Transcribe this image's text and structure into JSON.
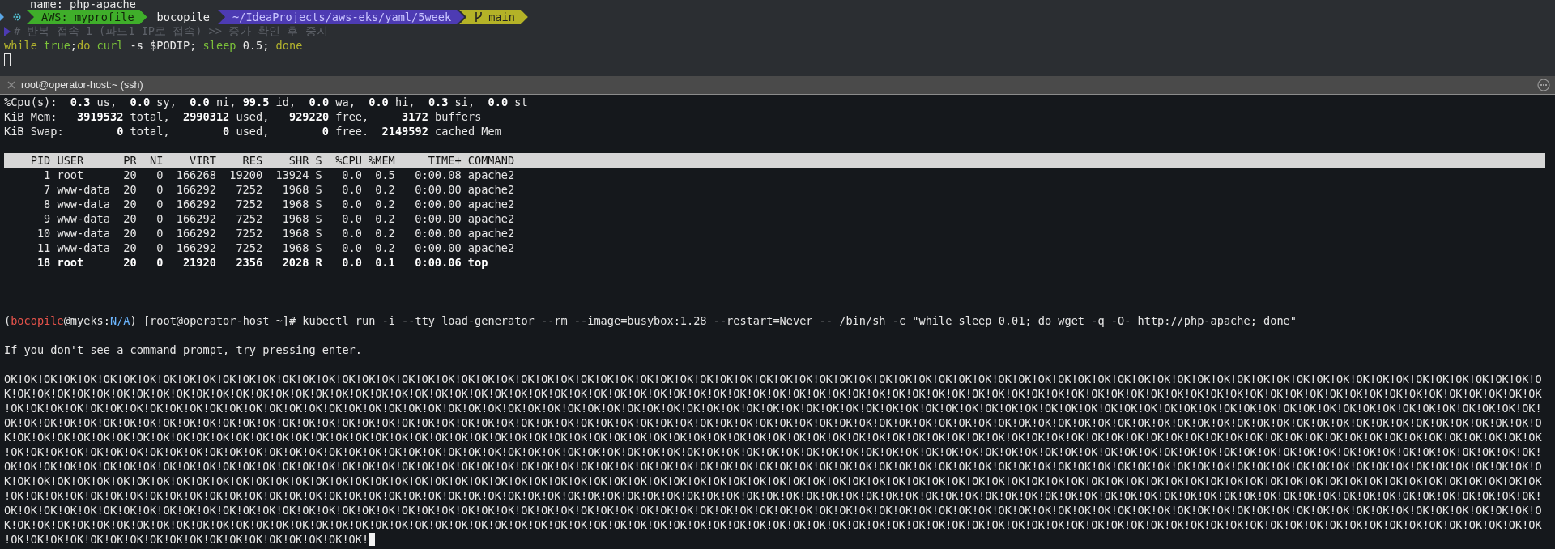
{
  "top_pane": {
    "clipped_line": "name: php-apache",
    "prompt_segments": [
      {
        "kind": "aws",
        "text": "AWS: myprofile"
      },
      {
        "kind": "user",
        "text": "bocopile"
      },
      {
        "kind": "path",
        "text": "~/IdeaProjects/aws-eks/yaml/5week"
      },
      {
        "kind": "git",
        "text": "main"
      }
    ],
    "comment": "# 반복 접속 1 (파드1 IP로 접속) >> 증가 확인 후 중지",
    "command": [
      {
        "kind": "keyword",
        "text": "while "
      },
      {
        "kind": "builtin",
        "text": "true"
      },
      {
        "kind": "plain",
        "text": ";"
      },
      {
        "kind": "keyword",
        "text": "do "
      },
      {
        "kind": "builtin",
        "text": "curl"
      },
      {
        "kind": "plain",
        "text": " -s $PODIP; "
      },
      {
        "kind": "builtin",
        "text": "sleep"
      },
      {
        "kind": "plain",
        "text": " 0.5; "
      },
      {
        "kind": "keyword",
        "text": "done"
      }
    ]
  },
  "tab": {
    "title": "root@operator-host:~ (ssh)"
  },
  "screen": {
    "stats": [
      "%Cpu(s):  **0.3** us,  **0.0** sy,  **0.0** ni, **99.5** id,  **0.0** wa,  **0.0** hi,  **0.3** si,  **0.0** st",
      "KiB Mem:   **3919532** total,  **2990312** used,   **929220** free,     **3172** buffers",
      "KiB Swap:        **0** total,        **0** used,        **0** free.  **2149592** cached Mem"
    ],
    "table": {
      "columns": [
        "PID",
        "USER",
        "PR",
        "NI",
        "VIRT",
        "RES",
        "SHR",
        "S",
        "%CPU",
        "%MEM",
        "TIME+",
        "COMMAND"
      ],
      "rows": [
        {
          "emphasized": false,
          "cells": [
            "1",
            "root",
            "20",
            "0",
            "166268",
            "19200",
            "13924",
            "S",
            "0.0",
            "0.5",
            "0:00.08",
            "apache2"
          ]
        },
        {
          "emphasized": false,
          "cells": [
            "7",
            "www-data",
            "20",
            "0",
            "166292",
            "7252",
            "1968",
            "S",
            "0.0",
            "0.2",
            "0:00.00",
            "apache2"
          ]
        },
        {
          "emphasized": false,
          "cells": [
            "8",
            "www-data",
            "20",
            "0",
            "166292",
            "7252",
            "1968",
            "S",
            "0.0",
            "0.2",
            "0:00.00",
            "apache2"
          ]
        },
        {
          "emphasized": false,
          "cells": [
            "9",
            "www-data",
            "20",
            "0",
            "166292",
            "7252",
            "1968",
            "S",
            "0.0",
            "0.2",
            "0:00.00",
            "apache2"
          ]
        },
        {
          "emphasized": false,
          "cells": [
            "10",
            "www-data",
            "20",
            "0",
            "166292",
            "7252",
            "1968",
            "S",
            "0.0",
            "0.2",
            "0:00.00",
            "apache2"
          ]
        },
        {
          "emphasized": false,
          "cells": [
            "11",
            "www-data",
            "20",
            "0",
            "166292",
            "7252",
            "1968",
            "S",
            "0.0",
            "0.2",
            "0:00.00",
            "apache2"
          ]
        },
        {
          "emphasized": true,
          "cells": [
            "18",
            "root",
            "20",
            "0",
            "21920",
            "2356",
            "2028",
            "R",
            "0.0",
            "0.1",
            "0:00.06",
            "top"
          ]
        }
      ]
    },
    "prompt": [
      {
        "kind": "plain",
        "text": "("
      },
      {
        "kind": "user",
        "text": "bocopile"
      },
      {
        "kind": "plain",
        "text": "@myeks:"
      },
      {
        "kind": "context",
        "text": "N/A"
      },
      {
        "kind": "plain",
        "text": ") [root@operator-host ~]# kubectl run -i --tty load-generator --rm --image=busybox:1.28 --restart=Never -- /bin/sh -c \"while sleep 0.01; do wget -q -O- http://php-apache; done\""
      }
    ],
    "notice": "If you don't see a command prompt, try pressing enter.",
    "output": [
      "OK!OK!OK!OK!OK!OK!OK!OK!OK!OK!OK!OK!OK!OK!OK!OK!OK!OK!OK!OK!OK!OK!OK!OK!OK!OK!OK!OK!OK!OK!OK!OK!OK!OK!OK!OK!OK!OK!OK!OK!OK!OK!OK!OK!OK!OK!OK!OK!OK!OK!OK!OK!OK!OK!OK!OK!OK!OK!OK!OK!OK!OK!OK!OK!OK!OK!OK!OK!OK!OK!OK!OK!OK!OK!OK!OK!OK!O",
      "K!OK!OK!OK!OK!OK!OK!OK!OK!OK!OK!OK!OK!OK!OK!OK!OK!OK!OK!OK!OK!OK!OK!OK!OK!OK!OK!OK!OK!OK!OK!OK!OK!OK!OK!OK!OK!OK!OK!OK!OK!OK!OK!OK!OK!OK!OK!OK!OK!OK!OK!OK!OK!OK!OK!OK!OK!OK!OK!OK!OK!OK!OK!OK!OK!OK!OK!OK!OK!OK!OK!OK!OK!OK!OK!OK!OK!OK",
      "!OK!OK!OK!OK!OK!OK!OK!OK!OK!OK!OK!OK!OK!OK!OK!OK!OK!OK!OK!OK!OK!OK!OK!OK!OK!OK!OK!OK!OK!OK!OK!OK!OK!OK!OK!OK!OK!OK!OK!OK!OK!OK!OK!OK!OK!OK!OK!OK!OK!OK!OK!OK!OK!OK!OK!OK!OK!OK!OK!OK!OK!OK!OK!OK!OK!OK!OK!OK!OK!OK!OK!OK!OK!OK!OK!OK!OK!",
      "OK!OK!OK!OK!OK!OK!OK!OK!OK!OK!OK!OK!OK!OK!OK!OK!OK!OK!OK!OK!OK!OK!OK!OK!OK!OK!OK!OK!OK!OK!OK!OK!OK!OK!OK!OK!OK!OK!OK!OK!OK!OK!OK!OK!OK!OK!OK!OK!OK!OK!OK!OK!OK!OK!OK!OK!OK!OK!OK!OK!OK!OK!OK!OK!OK!OK!OK!OK!OK!OK!OK!OK!OK!OK!OK!OK!OK!O",
      "K!OK!OK!OK!OK!OK!OK!OK!OK!OK!OK!OK!OK!OK!OK!OK!OK!OK!OK!OK!OK!OK!OK!OK!OK!OK!OK!OK!OK!OK!OK!OK!OK!OK!OK!OK!OK!OK!OK!OK!OK!OK!OK!OK!OK!OK!OK!OK!OK!OK!OK!OK!OK!OK!OK!OK!OK!OK!OK!OK!OK!OK!OK!OK!OK!OK!OK!OK!OK!OK!OK!OK!OK!OK!OK!OK!OK!OK",
      "!OK!OK!OK!OK!OK!OK!OK!OK!OK!OK!OK!OK!OK!OK!OK!OK!OK!OK!OK!OK!OK!OK!OK!OK!OK!OK!OK!OK!OK!OK!OK!OK!OK!OK!OK!OK!OK!OK!OK!OK!OK!OK!OK!OK!OK!OK!OK!OK!OK!OK!OK!OK!OK!OK!OK!OK!OK!OK!OK!OK!OK!OK!OK!OK!OK!OK!OK!OK!OK!OK!OK!OK!OK!OK!OK!OK!OK!",
      "OK!OK!OK!OK!OK!OK!OK!OK!OK!OK!OK!OK!OK!OK!OK!OK!OK!OK!OK!OK!OK!OK!OK!OK!OK!OK!OK!OK!OK!OK!OK!OK!OK!OK!OK!OK!OK!OK!OK!OK!OK!OK!OK!OK!OK!OK!OK!OK!OK!OK!OK!OK!OK!OK!OK!OK!OK!OK!OK!OK!OK!OK!OK!OK!OK!OK!OK!OK!OK!OK!OK!OK!OK!OK!OK!OK!OK!O",
      "K!OK!OK!OK!OK!OK!OK!OK!OK!OK!OK!OK!OK!OK!OK!OK!OK!OK!OK!OK!OK!OK!OK!OK!OK!OK!OK!OK!OK!OK!OK!OK!OK!OK!OK!OK!OK!OK!OK!OK!OK!OK!OK!OK!OK!OK!OK!OK!OK!OK!OK!OK!OK!OK!OK!OK!OK!OK!OK!OK!OK!OK!OK!OK!OK!OK!OK!OK!OK!OK!OK!OK!OK!OK!OK!OK!OK!OK",
      "!OK!OK!OK!OK!OK!OK!OK!OK!OK!OK!OK!OK!OK!OK!OK!OK!OK!OK!OK!OK!OK!OK!OK!OK!OK!OK!OK!OK!OK!OK!OK!OK!OK!OK!OK!OK!OK!OK!OK!OK!OK!OK!OK!OK!OK!OK!OK!OK!OK!OK!OK!OK!OK!OK!OK!OK!OK!OK!OK!OK!OK!OK!OK!OK!OK!OK!OK!OK!OK!OK!OK!OK!OK!OK!OK!OK!OK!",
      "OK!OK!OK!OK!OK!OK!OK!OK!OK!OK!OK!OK!OK!OK!OK!OK!OK!OK!OK!OK!OK!OK!OK!OK!OK!OK!OK!OK!OK!OK!OK!OK!OK!OK!OK!OK!OK!OK!OK!OK!OK!OK!OK!OK!OK!OK!OK!OK!OK!OK!OK!OK!OK!OK!OK!OK!OK!OK!OK!OK!OK!OK!OK!OK!OK!OK!OK!OK!OK!OK!OK!OK!OK!OK!OK!OK!OK!O",
      "K!OK!OK!OK!OK!OK!OK!OK!OK!OK!OK!OK!OK!OK!OK!OK!OK!OK!OK!OK!OK!OK!OK!OK!OK!OK!OK!OK!OK!OK!OK!OK!OK!OK!OK!OK!OK!OK!OK!OK!OK!OK!OK!OK!OK!OK!OK!OK!OK!OK!OK!OK!OK!OK!OK!OK!OK!OK!OK!OK!OK!OK!OK!OK!OK!OK!OK!OK!OK!OK!OK!OK!OK!OK!OK!OK!OK!OK",
      "!OK!OK!OK!OK!OK!OK!OK!OK!OK!OK!OK!OK!OK!OK!OK!OK!OK!OK!"
    ]
  }
}
